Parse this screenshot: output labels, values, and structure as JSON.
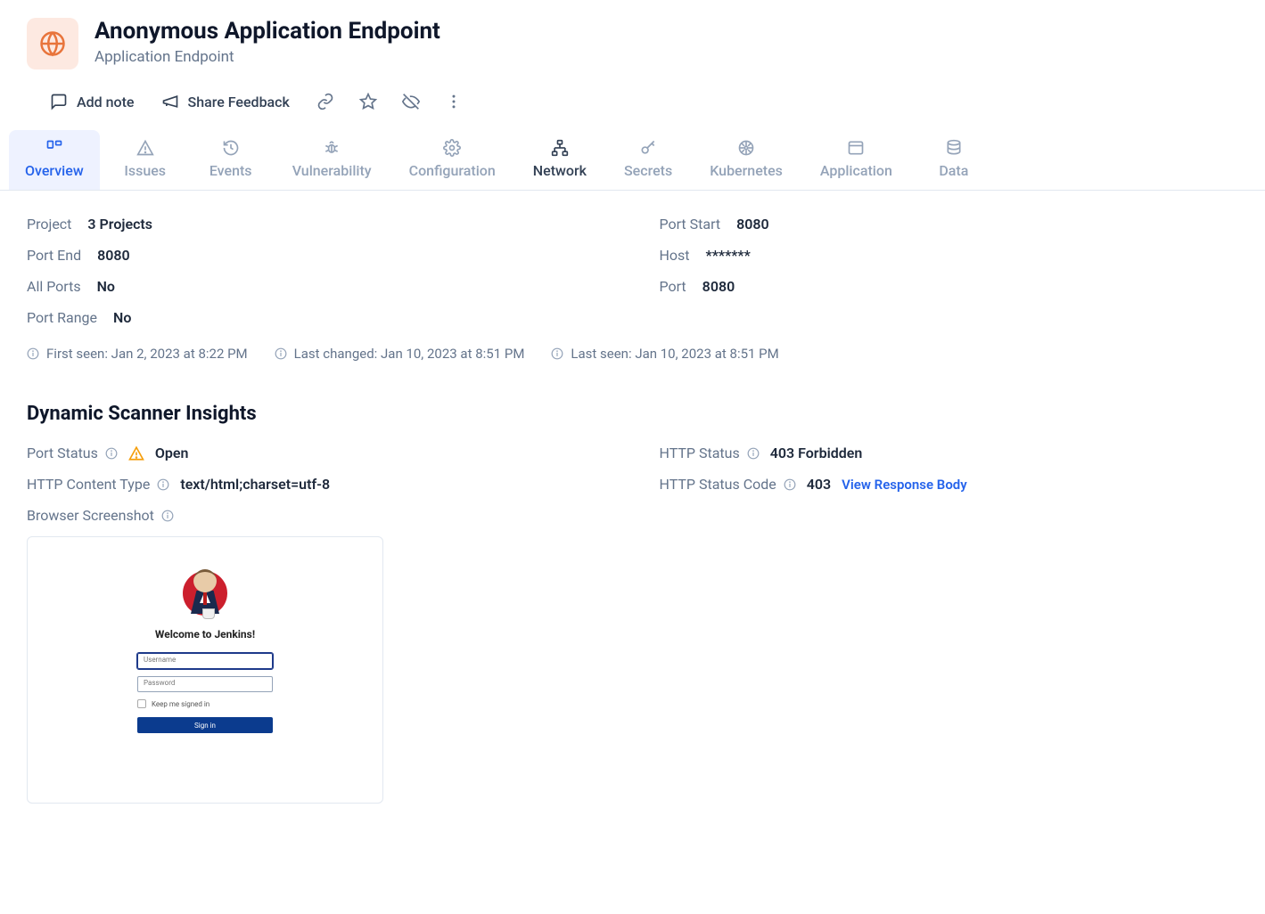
{
  "header": {
    "title": "Anonymous Application Endpoint",
    "subtitle": "Application Endpoint"
  },
  "actions": {
    "add_note": "Add note",
    "share_feedback": "Share Feedback"
  },
  "tabs": {
    "overview": "Overview",
    "issues": "Issues",
    "events": "Events",
    "vulnerability": "Vulnerability",
    "configuration": "Configuration",
    "network": "Network",
    "secrets": "Secrets",
    "kubernetes": "Kubernetes",
    "application": "Application",
    "data": "Data"
  },
  "details": {
    "project_label": "Project",
    "project_value": "3 Projects",
    "port_start_label": "Port Start",
    "port_start_value": "8080",
    "port_end_label": "Port End",
    "port_end_value": "8080",
    "host_label": "Host",
    "host_value": "*******",
    "all_ports_label": "All Ports",
    "all_ports_value": "No",
    "port_label": "Port",
    "port_value": "8080",
    "port_range_label": "Port Range",
    "port_range_value": "No"
  },
  "timestamps": {
    "first_seen": "First seen: Jan 2, 2023 at 8:22 PM",
    "last_changed": "Last changed: Jan 10, 2023 at 8:51 PM",
    "last_seen": "Last seen: Jan 10, 2023 at 8:51 PM"
  },
  "insights": {
    "section_title": "Dynamic Scanner Insights",
    "port_status_label": "Port Status",
    "port_status_value": "Open",
    "http_status_label": "HTTP Status",
    "http_status_value": "403 Forbidden",
    "http_content_type_label": "HTTP Content Type",
    "http_content_type_value": "text/html;charset=utf-8",
    "http_status_code_label": "HTTP Status Code",
    "http_status_code_value": "403",
    "view_response_body": "View Response Body",
    "browser_screenshot_label": "Browser Screenshot"
  },
  "screenshot": {
    "welcome": "Welcome to Jenkins!",
    "username_placeholder": "Username",
    "password_placeholder": "Password",
    "keep_signed_in": "Keep me signed in",
    "sign_in": "Sign in"
  }
}
